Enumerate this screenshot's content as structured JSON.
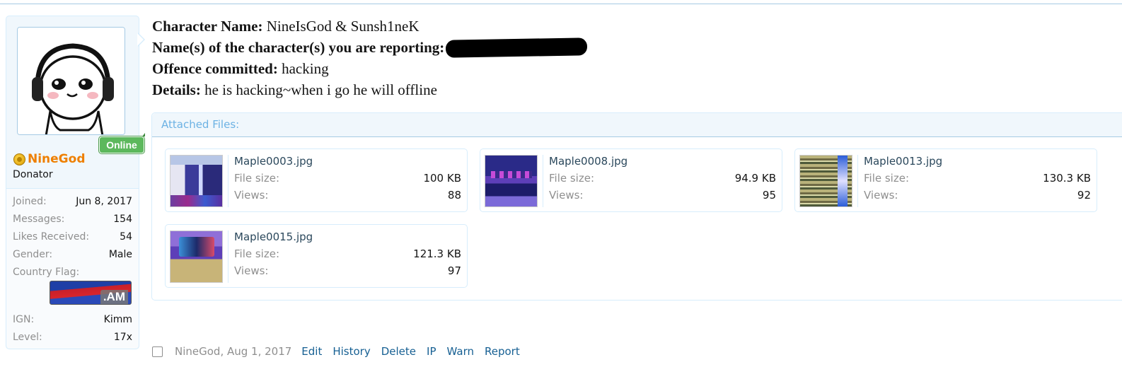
{
  "user": {
    "username": "NineGod",
    "title": "Donator",
    "online_label": "Online",
    "extras": [
      {
        "label": "Joined:",
        "value": "Jun 8, 2017"
      },
      {
        "label": "Messages:",
        "value": "154"
      },
      {
        "label": "Likes Received:",
        "value": "54"
      },
      {
        "label": "Gender:",
        "value": "Male"
      },
      {
        "label": "Country Flag:",
        "value": ""
      },
      {
        "label": "IGN:",
        "value": "Kimm"
      },
      {
        "label": "Level:",
        "value": "17x"
      }
    ],
    "flag_code": ".AM",
    "colors": {
      "username": "#ee7f00",
      "online": "#5cb85c"
    }
  },
  "message": {
    "lines": [
      {
        "label": "Character Name:",
        "value": "NineIsGod & Sunsh1neK"
      },
      {
        "label": "Name(s) of the character(s) you are reporting:",
        "value": ""
      },
      {
        "label": "Offence committed:",
        "value": "hacking"
      },
      {
        "label": "Details:",
        "value": "he is hacking~when i go he will offline"
      }
    ]
  },
  "attachments": {
    "header": "Attached Files:",
    "size_label": "File size:",
    "views_label": "Views:",
    "files": [
      {
        "name": "Maple0003.jpg",
        "size": "100 KB",
        "views": "88"
      },
      {
        "name": "Maple0008.jpg",
        "size": "94.9 KB",
        "views": "95"
      },
      {
        "name": "Maple0013.jpg",
        "size": "130.3 KB",
        "views": "92"
      },
      {
        "name": "Maple0015.jpg",
        "size": "121.3 KB",
        "views": "97"
      }
    ]
  },
  "footer": {
    "meta": "NineGod, Aug 1, 2017",
    "links": [
      "Edit",
      "History",
      "Delete",
      "IP",
      "Warn",
      "Report"
    ]
  }
}
